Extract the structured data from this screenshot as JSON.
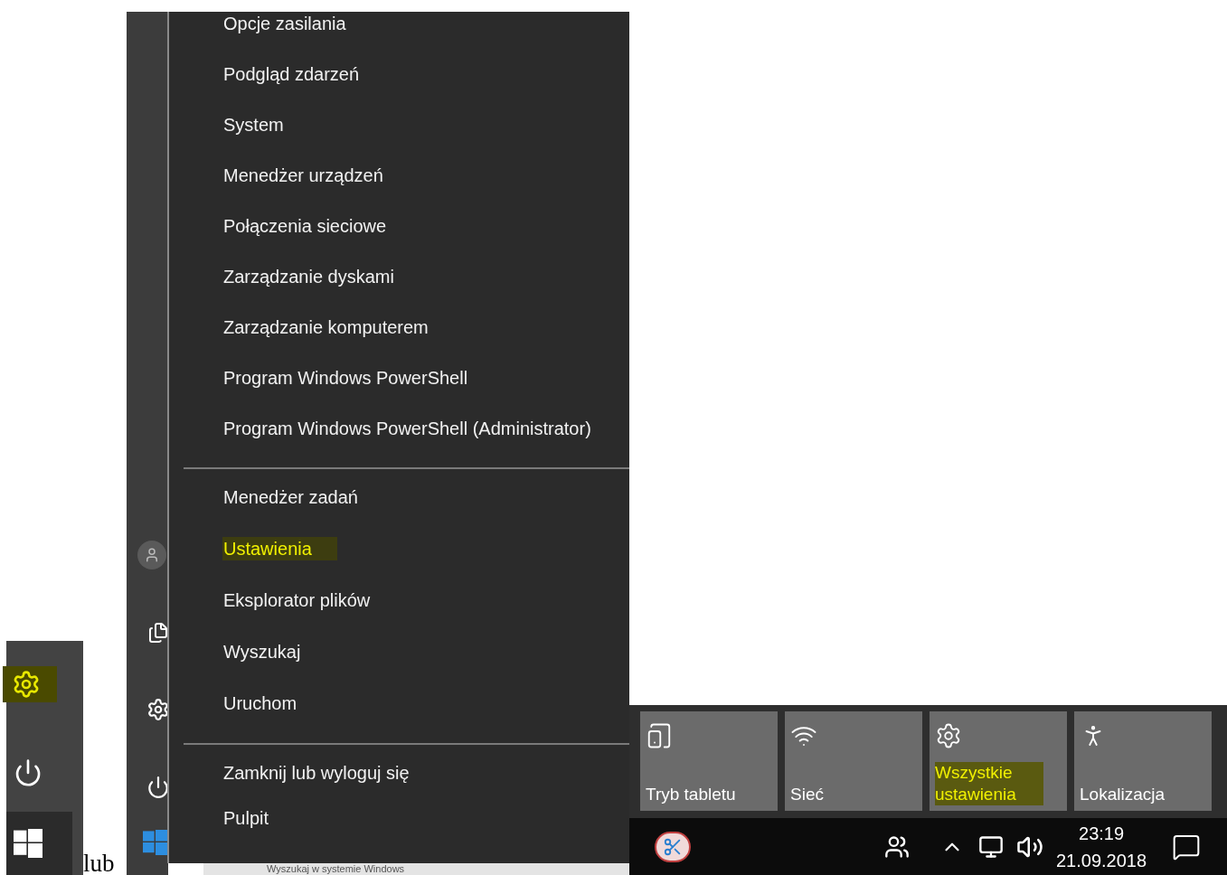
{
  "start_strip": {
    "gear_highlighted": true
  },
  "connector_text": "lub",
  "power_menu": {
    "groups": [
      {
        "items": [
          {
            "label": "Opcje zasilania",
            "highlighted": false
          },
          {
            "label": "Podgląd zdarzeń",
            "highlighted": false
          },
          {
            "label": "System",
            "highlighted": false
          },
          {
            "label": "Menedżer urządzeń",
            "highlighted": false
          },
          {
            "label": "Połączenia sieciowe",
            "highlighted": false
          },
          {
            "label": "Zarządzanie dyskami",
            "highlighted": false
          },
          {
            "label": "Zarządzanie komputerem",
            "highlighted": false
          },
          {
            "label": "Program Windows PowerShell",
            "highlighted": false
          },
          {
            "label": "Program Windows PowerShell (Administrator)",
            "highlighted": false
          }
        ]
      },
      {
        "items": [
          {
            "label": "Menedżer zadań",
            "highlighted": false
          },
          {
            "label": "Ustawienia",
            "highlighted": true
          },
          {
            "label": "Eksplorator plików",
            "highlighted": false
          },
          {
            "label": "Wyszukaj",
            "highlighted": false
          },
          {
            "label": "Uruchom",
            "highlighted": false
          }
        ]
      },
      {
        "items": [
          {
            "label": "Zamknij lub wyloguj się",
            "highlighted": false
          },
          {
            "label": "Pulpit",
            "highlighted": false
          }
        ]
      }
    ]
  },
  "search_box": {
    "placeholder": "Wyszukaj w systemie Windows"
  },
  "quick_actions": [
    {
      "kind": "tablet",
      "label": "Tryb tabletu",
      "highlighted": false
    },
    {
      "kind": "network",
      "label": "Sieć",
      "highlighted": false
    },
    {
      "kind": "settings",
      "label": "Wszystkie ustawienia",
      "highlighted": true
    },
    {
      "kind": "location",
      "label": "Lokalizacja",
      "highlighted": false
    }
  ],
  "taskbar": {
    "time": "23:19",
    "date": "21.09.2018"
  }
}
